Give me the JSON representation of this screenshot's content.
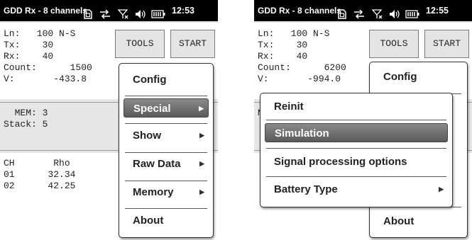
{
  "statusbar": {
    "title": "GDD Rx - 8 channels",
    "time_1": "12:53",
    "time_2": "12:55"
  },
  "screen1": {
    "info": {
      "ln": "Ln:   100 N-S",
      "tx": "Tx:    30",
      "rx": "Rx:    40",
      "count": "Count:      1500",
      "v": "V:       -433.8"
    },
    "tools_label": "TOOLS",
    "start_label": "START",
    "mem": "  MEM: 3",
    "stack": "Stack: 5",
    "grid": {
      "header": "CH       Rho",
      "rows": [
        "01      32.34",
        "02      42.25"
      ]
    },
    "menu": {
      "items": [
        "Config",
        "Special",
        "Show",
        "Raw Data",
        "Memory",
        "About"
      ],
      "selected": "Special"
    }
  },
  "screen2": {
    "info": {
      "ln": "Ln:   100 N-S",
      "tx": "Tx:    30",
      "rx": "Rx:    40",
      "count": "Count:      6200",
      "v": "V:       -994.0"
    },
    "tools_label": "TOOLS",
    "start_label": "START",
    "mem_fragment": "M",
    "menu_main": {
      "config": "Config",
      "about": "About"
    },
    "submenu": {
      "items": [
        "Reinit",
        "Simulation",
        "Signal processing options",
        "Battery Type"
      ],
      "selected": "Simulation"
    }
  },
  "icons": [
    "sim-card-icon",
    "sync-arrows-icon",
    "no-signal-icon",
    "volume-icon",
    "battery-icon",
    "chevron-right-icon"
  ]
}
